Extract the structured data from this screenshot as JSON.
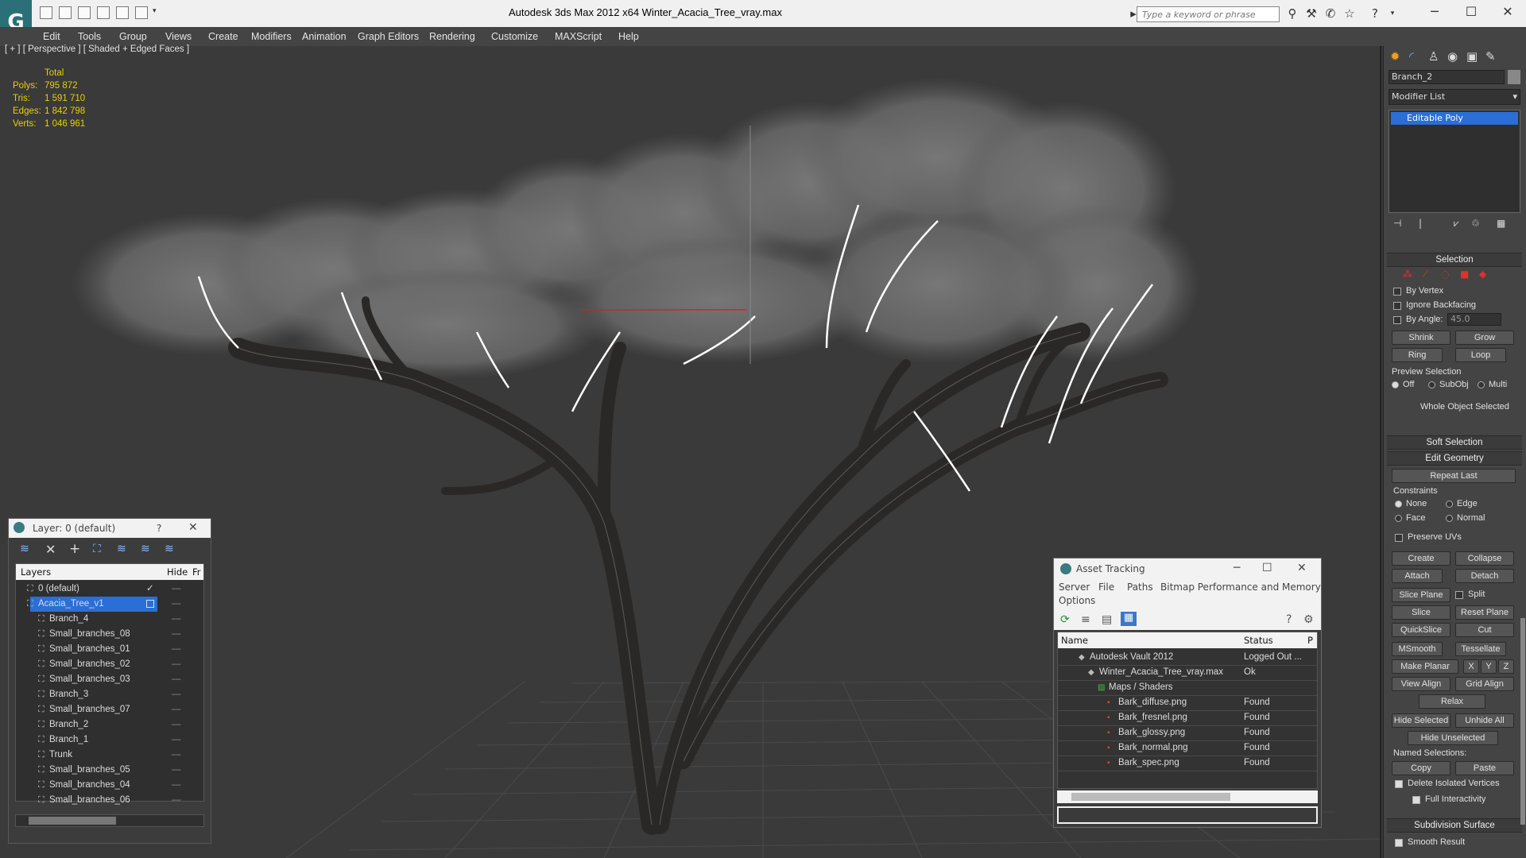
{
  "window": {
    "title": "Autodesk 3ds Max  2012 x64      Winter_Acacia_Tree_vray.max",
    "search_placeholder": "Type a keyword or phrase"
  },
  "menu": [
    "Edit",
    "Tools",
    "Group",
    "Views",
    "Create",
    "Modifiers",
    "Animation",
    "Graph Editors",
    "Rendering",
    "Customize",
    "MAXScript",
    "Help"
  ],
  "viewport": {
    "label": "[ + ] [ Perspective ] [ Shaded + Edged Faces ]",
    "stats_header": "Total",
    "stats": [
      {
        "label": "Polys:",
        "value": "795 872"
      },
      {
        "label": "Tris:",
        "value": "1 591 710"
      },
      {
        "label": "Edges:",
        "value": "1 842 798"
      },
      {
        "label": "Verts:",
        "value": "1 046 961"
      }
    ]
  },
  "layer_window": {
    "title": "Layer: 0 (default)",
    "help": "?",
    "col_layers": "Layers",
    "col_hide": "Hide",
    "col_fr": "Fr",
    "rows": [
      {
        "name": "0 (default)",
        "indent": 1,
        "check": true
      },
      {
        "name": "Acacia_Tree_v1",
        "indent": 1,
        "selected": true
      },
      {
        "name": "Branch_4",
        "indent": 2
      },
      {
        "name": "Small_branches_08",
        "indent": 2
      },
      {
        "name": "Small_branches_01",
        "indent": 2
      },
      {
        "name": "Small_branches_02",
        "indent": 2
      },
      {
        "name": "Small_branches_03",
        "indent": 2
      },
      {
        "name": "Branch_3",
        "indent": 2
      },
      {
        "name": "Small_branches_07",
        "indent": 2
      },
      {
        "name": "Branch_2",
        "indent": 2
      },
      {
        "name": "Branch_1",
        "indent": 2
      },
      {
        "name": "Trunk",
        "indent": 2
      },
      {
        "name": "Small_branches_05",
        "indent": 2
      },
      {
        "name": "Small_branches_04",
        "indent": 2
      },
      {
        "name": "Small_branches_06",
        "indent": 2
      }
    ]
  },
  "asset_window": {
    "title": "Asset Tracking",
    "menu": [
      "Server",
      "File",
      "Paths",
      "Bitmap Performance and Memory",
      "Options"
    ],
    "col_name": "Name",
    "col_status": "Status",
    "col_p": "P",
    "rows": [
      {
        "name": "Autodesk Vault 2012",
        "status": "Logged Out ...",
        "indent": 1
      },
      {
        "name": "Winter_Acacia_Tree_vray.max",
        "status": "Ok",
        "indent": 2
      },
      {
        "name": "Maps / Shaders",
        "status": "",
        "indent": 3
      },
      {
        "name": "Bark_diffuse.png",
        "status": "Found",
        "indent": 4
      },
      {
        "name": "Bark_fresnel.png",
        "status": "Found",
        "indent": 4
      },
      {
        "name": "Bark_glossy.png",
        "status": "Found",
        "indent": 4
      },
      {
        "name": "Bark_normal.png",
        "status": "Found",
        "indent": 4
      },
      {
        "name": "Bark_spec.png",
        "status": "Found",
        "indent": 4
      }
    ]
  },
  "command_panel": {
    "object_name": "Branch_2",
    "modifier_list": "Modifier List",
    "stack_item": "Editable Poly",
    "selection": {
      "title": "Selection",
      "by_vertex": "By Vertex",
      "ignore_backfacing": "Ignore Backfacing",
      "by_angle": "By Angle:",
      "angle_value": "45.0",
      "shrink": "Shrink",
      "grow": "Grow",
      "ring": "Ring",
      "loop": "Loop",
      "preview_selection": "Preview Selection",
      "off": "Off",
      "subobj": "SubObj",
      "multi": "Multi",
      "status": "Whole Object Selected"
    },
    "soft_selection": "Soft Selection",
    "edit_geometry": {
      "title": "Edit Geometry",
      "repeat_last": "Repeat Last",
      "constraints": "Constraints",
      "none": "None",
      "edge": "Edge",
      "face": "Face",
      "normal": "Normal",
      "preserve_uvs": "Preserve UVs",
      "create": "Create",
      "collapse": "Collapse",
      "attach": "Attach",
      "detach": "Detach",
      "slice_plane": "Slice Plane",
      "split": "Split",
      "slice": "Slice",
      "reset_plane": "Reset Plane",
      "quickslice": "QuickSlice",
      "cut": "Cut",
      "msmooth": "MSmooth",
      "tessellate": "Tessellate",
      "make_planar": "Make Planar",
      "x": "X",
      "y": "Y",
      "z": "Z",
      "view_align": "View Align",
      "grid_align": "Grid Align",
      "relax": "Relax",
      "hide_selected": "Hide Selected",
      "unhide_all": "Unhide All",
      "hide_unselected": "Hide Unselected",
      "named_selections": "Named Selections:",
      "copy": "Copy",
      "paste": "Paste",
      "delete_isolated": "Delete Isolated Vertices",
      "full_interactivity": "Full Interactivity"
    },
    "subdivision_surface": "Subdivision Surface",
    "smooth_result": "Smooth Result"
  },
  "colors": {
    "viewport_bg": "#3a3a3a",
    "stats_yellow": "#e8d000",
    "selection_blue": "#2a6fd6",
    "wire_white": "#ffffff"
  }
}
